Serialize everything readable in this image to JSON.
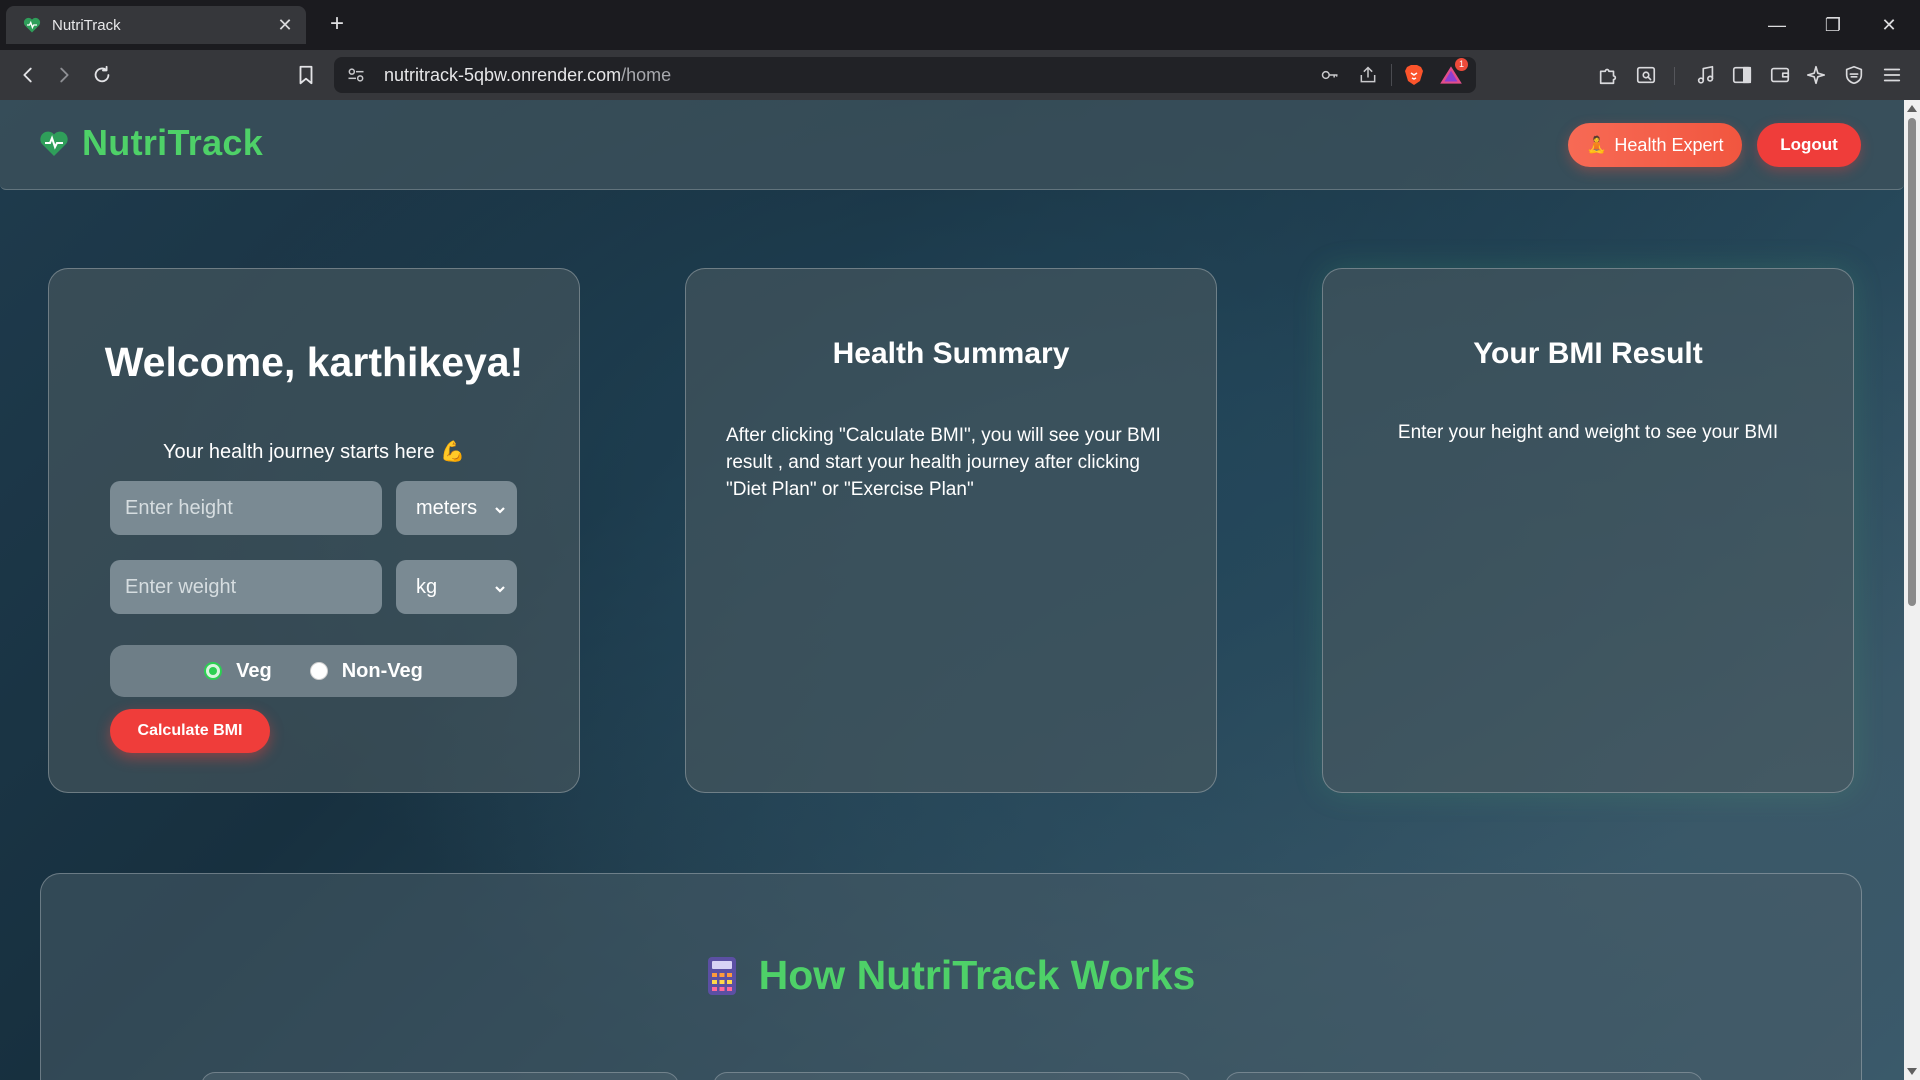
{
  "browser": {
    "tab_title": "NutriTrack",
    "url_host": "nutritrack-5qbw.onrender.com",
    "url_path": "/home",
    "rewards_badge": "1"
  },
  "header": {
    "brand": "NutriTrack",
    "health_expert_emoji": "🧘",
    "health_expert_label": "Health Expert",
    "logout_label": "Logout"
  },
  "welcome_card": {
    "greeting": "Welcome, karthikeya!",
    "tagline": "Your health journey starts here 💪",
    "height_placeholder": "Enter height",
    "height_unit": "meters",
    "weight_placeholder": "Enter weight",
    "weight_unit": "kg",
    "diet_options": [
      "Veg",
      "Non-Veg"
    ],
    "diet_selected": "Veg",
    "calculate_label": "Calculate BMI"
  },
  "summary_card": {
    "title": "Health Summary",
    "text": "After clicking \"Calculate BMI\", you will see your BMI result , and start your health journey after clicking \"Diet Plan\" or \"Exercise Plan\""
  },
  "bmi_card": {
    "title": "Your BMI Result",
    "text": "Enter your height and weight to see your BMI"
  },
  "how_it_works": {
    "title": "How NutriTrack Works"
  },
  "colors": {
    "brand_green": "#4ed168",
    "accent_red": "#ef3d3a",
    "accent_coral": "#f76a55"
  }
}
